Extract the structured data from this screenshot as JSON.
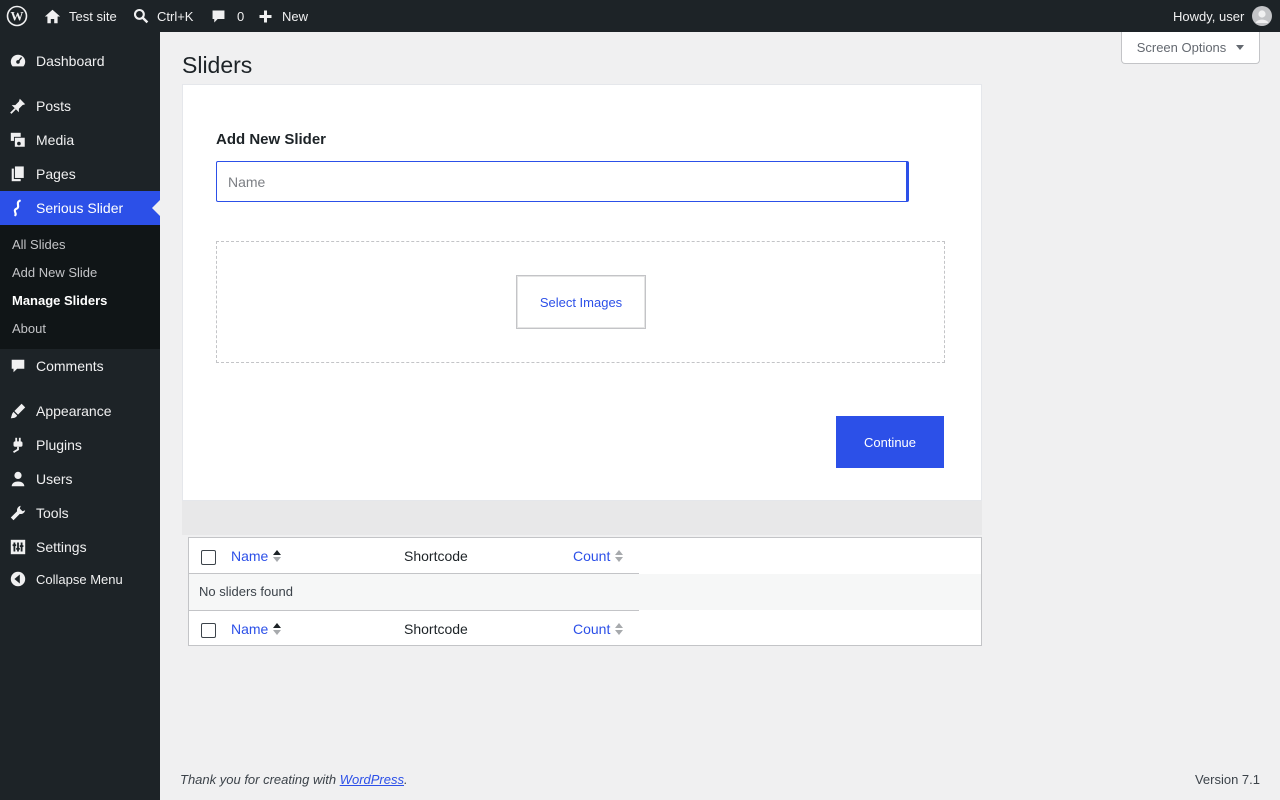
{
  "adminbar": {
    "site_name": "Test site",
    "search_shortcut": "Ctrl+K",
    "comments_count": "0",
    "new_label": "New",
    "howdy": "Howdy, user"
  },
  "sidebar": {
    "items": [
      {
        "label": "Dashboard",
        "icon": "dashboard-icon"
      },
      {
        "label": "Posts",
        "icon": "pin-icon"
      },
      {
        "label": "Media",
        "icon": "media-icon"
      },
      {
        "label": "Pages",
        "icon": "pages-icon"
      },
      {
        "label": "Serious Slider",
        "icon": "slider-icon"
      },
      {
        "label": "Comments",
        "icon": "comment-icon"
      },
      {
        "label": "Appearance",
        "icon": "brush-icon"
      },
      {
        "label": "Plugins",
        "icon": "plug-icon"
      },
      {
        "label": "Users",
        "icon": "user-icon"
      },
      {
        "label": "Tools",
        "icon": "wrench-icon"
      },
      {
        "label": "Settings",
        "icon": "settings-icon"
      },
      {
        "label": "Collapse Menu",
        "icon": "collapse-icon"
      }
    ],
    "submenu": [
      "All Slides",
      "Add New Slide",
      "Manage Sliders",
      "About"
    ],
    "active_submenu": "Manage Sliders"
  },
  "screen_options": "Screen Options",
  "page": {
    "title": "Sliders",
    "form_label": "Add New Slider",
    "name_placeholder": "Name",
    "select_images": "Select Images",
    "continue": "Continue"
  },
  "table": {
    "columns": {
      "name": "Name",
      "shortcode": "Shortcode",
      "count": "Count"
    },
    "empty_message": "No sliders found"
  },
  "footer": {
    "thanks_prefix": "Thank you for creating with ",
    "wordpress_link": "WordPress",
    "thanks_suffix": ".",
    "version": "Version 7.1"
  },
  "colors": {
    "accent": "#2c50e8",
    "sidebar_bg": "#1d2327",
    "submenu_bg": "#101517"
  }
}
